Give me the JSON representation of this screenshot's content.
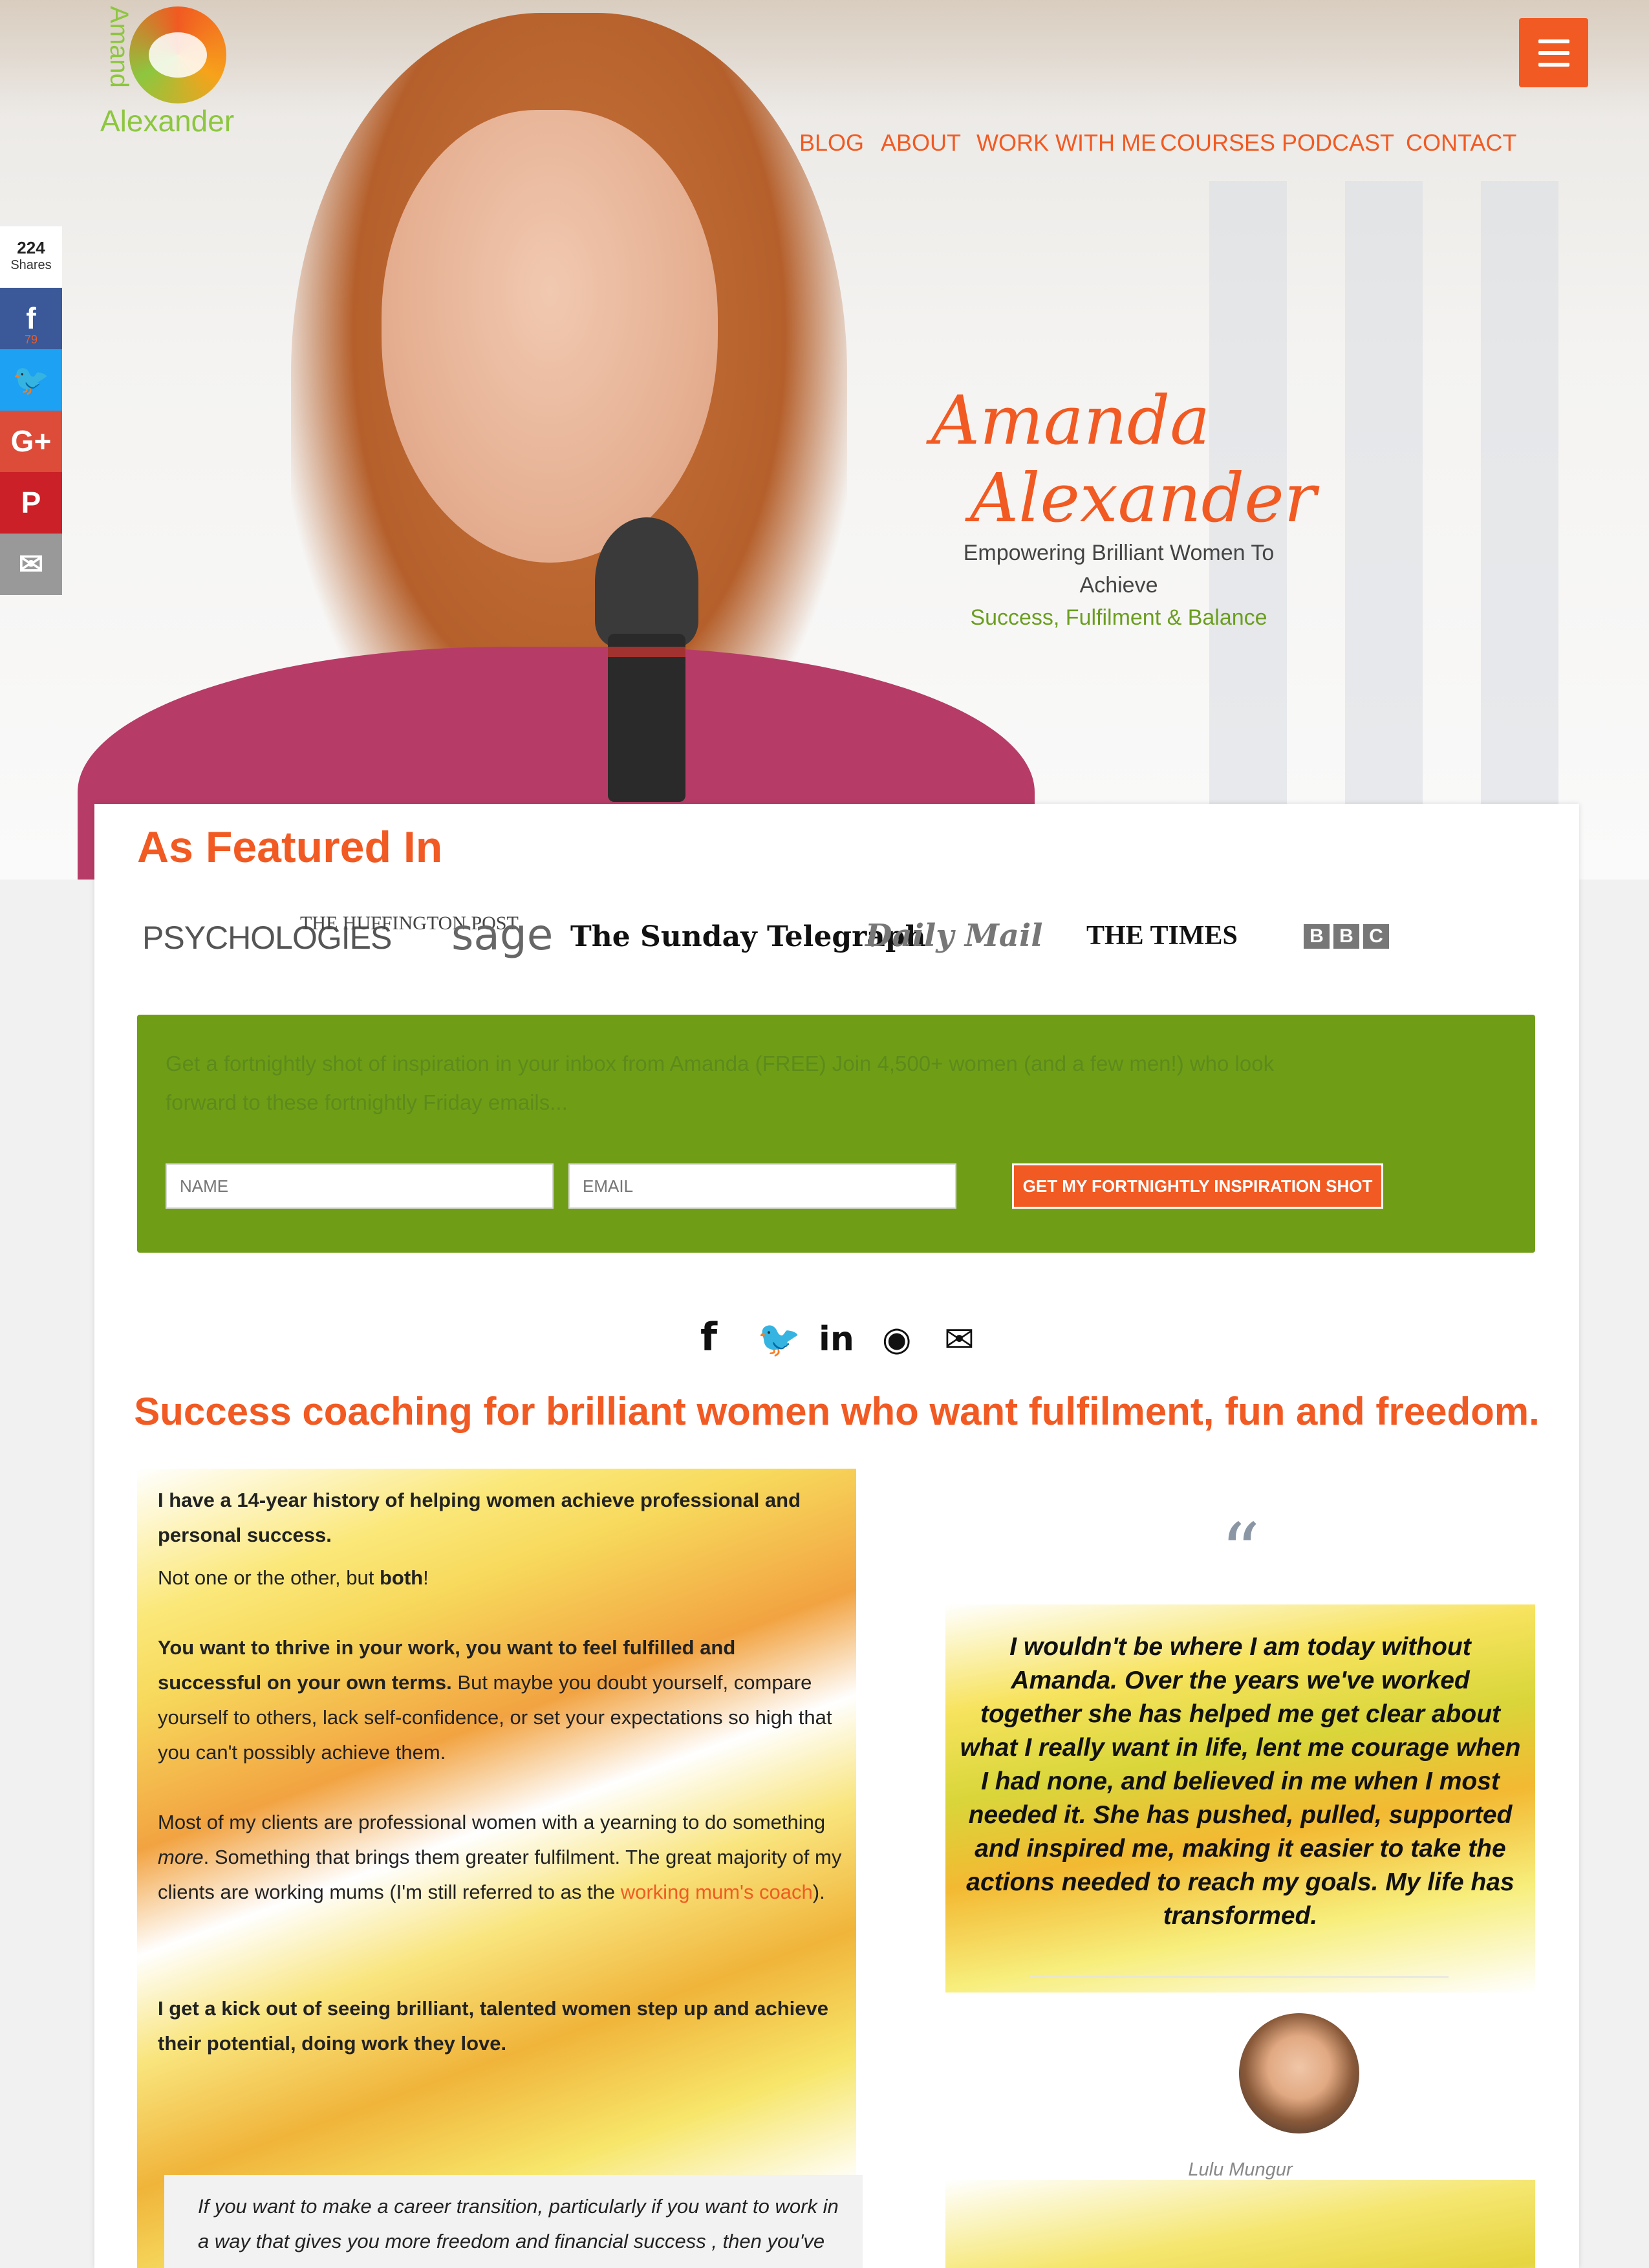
{
  "logo": {
    "first": "Amand",
    "last": "Alexander"
  },
  "nav": {
    "items": [
      "BLOG",
      "ABOUT",
      "WORK WITH ME",
      "COURSES",
      "PODCAST",
      "CONTACT"
    ],
    "menu_icon": "hamburger-icon"
  },
  "hero": {
    "name_line1": "Amanda",
    "name_line2": "Alexander",
    "sub_line1": "Empowering Brilliant Women To Achieve",
    "sub_line2": "Success, Fulfilment & Balance"
  },
  "share_bar": {
    "count": "224",
    "count_label": "Shares",
    "facebook_count": "79",
    "buttons": [
      {
        "name": "facebook",
        "glyph": "f",
        "color": "#3b5998"
      },
      {
        "name": "twitter",
        "glyph": "🐦",
        "color": "#1da1f2"
      },
      {
        "name": "google-plus",
        "glyph": "G+",
        "color": "#dd4b39"
      },
      {
        "name": "pinterest",
        "glyph": "P",
        "color": "#cb2027"
      },
      {
        "name": "email",
        "glyph": "✉",
        "color": "#999999"
      }
    ]
  },
  "featured": {
    "heading": "As Featured In",
    "logos": [
      "PSYCHOLOGIES",
      "THE HUFFINGTON POST",
      "sage",
      "The Sunday Telegraph",
      "Daily Mail",
      "THE TIMES",
      "BBC"
    ]
  },
  "optin": {
    "text": "Get a fortnightly shot of inspiration in your inbox from Amanda (FREE) Join 4,500+ women (and a few men!) who look forward to these fortnightly Friday emails...",
    "name_placeholder": "NAME",
    "email_placeholder": "EMAIL",
    "submit_label": "GET MY FORTNIGHTLY INSPIRATION SHOT"
  },
  "social_icons": [
    "facebook-icon",
    "twitter-icon",
    "linkedin-icon",
    "rss-icon",
    "email-icon"
  ],
  "tagline": "Success coaching for brilliant women who want fulfilment, fun and freedom.",
  "body": {
    "p1": "I have a 14-year history of helping women achieve professional and personal success.",
    "p2a": "Not one or the other, but ",
    "p2b": "both",
    "p2c": "!",
    "p3a": "You want to thrive in your work, you want to feel fulfilled and successful on your own terms.",
    "p3b": "  But maybe you doubt yourself, compare yourself to others, lack self-confidence, or set your expectations so high that you can't possibly achieve them.",
    "p4a": "Most of my clients are professional women with a yearning to do something ",
    "p4b": "more",
    "p4c": ". Something that brings them greater fulfilment.  The great majority of my clients are working mums (I'm still referred to as the ",
    "p4link": "working mum's coach",
    "p4d": ").",
    "p5": "I get a kick out of seeing brilliant, talented women step up and achieve their potential, doing work they love.",
    "callout": "If you want to make a career transition,  particularly if you want to work in a way that gives you more freedom and financial success , then you've found the right Coach!"
  },
  "testimonial": {
    "mark": "“",
    "quote": "I wouldn't be where I am today without Amanda. Over the years we've worked together she has helped me get clear about what I really want in life, lent me courage when I had none, and believed in me when I most needed it. She has pushed, pulled, supported and inspired me, making it easier to take the actions needed to reach my goals. My life has transformed.",
    "author": "Lulu Mungur"
  },
  "colors": {
    "accent": "#f15a22",
    "green": "#6f9e16",
    "brand_green": "#8dc63f"
  }
}
